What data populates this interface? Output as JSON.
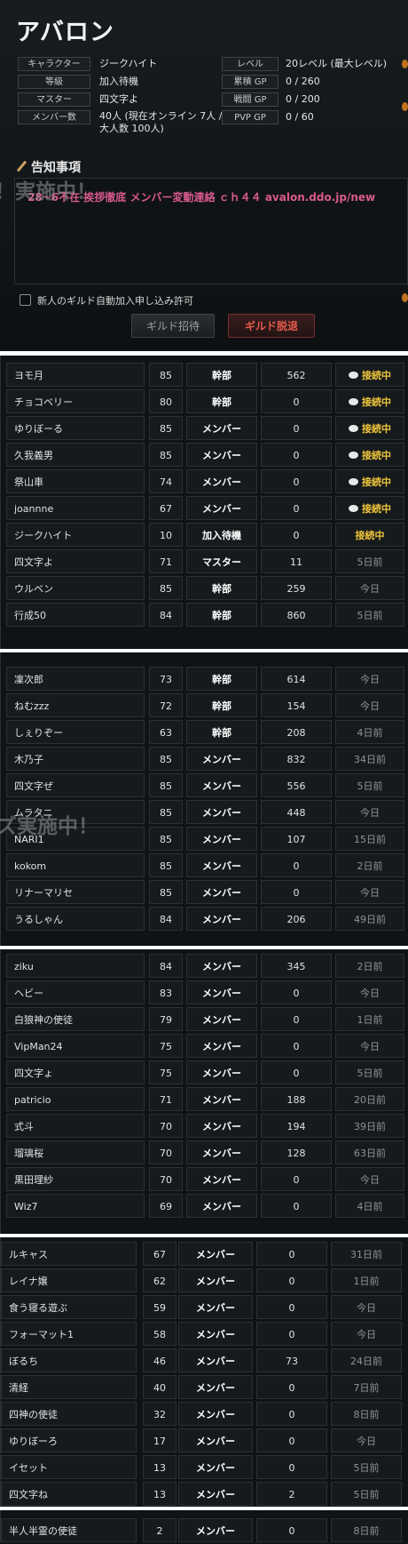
{
  "guild": {
    "name": "アバロン",
    "info_left": [
      {
        "label": "キャラクター",
        "value": "ジークハイト"
      },
      {
        "label": "等級",
        "value": "加入待機"
      },
      {
        "label": "マスター",
        "value": "四文字よ"
      },
      {
        "label": "メンバー数",
        "value": "40人 (現在オンライン 7人 / 最大人数 100人)"
      }
    ],
    "info_right": [
      {
        "label": "レベル",
        "value": "20レベル (最大レベル)"
      },
      {
        "label": "累積 GP",
        "value": "0 / 260"
      },
      {
        "label": "戦闘 GP",
        "value": "0 / 200"
      },
      {
        "label": "PVP GP",
        "value": "0 / 60"
      }
    ],
    "notice_title": "告知事項",
    "notice_text": "28~6不在  挨拶徹底  メンバー変動連絡  ｃｈ４４  avalon.ddo.jp/new",
    "watermark_1": "！実施中！",
    "watermark_2": "ズ実施中！",
    "auto_join_label": "新人のギルド自動加入申し込み許可",
    "invite_button": "ギルド招待",
    "leave_button": "ギルド脱退"
  },
  "members": [
    [
      {
        "name": "ヨモ月",
        "level": "85",
        "rank": "幹部",
        "gp": "562",
        "status": "接続中",
        "online": true
      },
      {
        "name": "チョコベリー",
        "level": "80",
        "rank": "幹部",
        "gp": "0",
        "status": "接続中",
        "online": true
      },
      {
        "name": "ゆりぼーる",
        "level": "85",
        "rank": "メンバー",
        "gp": "0",
        "status": "接続中",
        "online": true
      },
      {
        "name": "久我義男",
        "level": "85",
        "rank": "メンバー",
        "gp": "0",
        "status": "接続中",
        "online": true
      },
      {
        "name": "祭山車",
        "level": "74",
        "rank": "メンバー",
        "gp": "0",
        "status": "接続中",
        "online": true
      },
      {
        "name": "joannne",
        "level": "67",
        "rank": "メンバー",
        "gp": "0",
        "status": "接続中",
        "online": true
      },
      {
        "name": "ジークハイト",
        "level": "10",
        "rank": "加入待機",
        "gp": "0",
        "status": "接続中",
        "online": true,
        "noicon": true
      },
      {
        "name": "四文字よ",
        "level": "71",
        "rank": "マスター",
        "gp": "11",
        "status": "5日前",
        "online": false
      },
      {
        "name": "ウルベン",
        "level": "85",
        "rank": "幹部",
        "gp": "259",
        "status": "今日",
        "online": false
      },
      {
        "name": "行成50",
        "level": "84",
        "rank": "幹部",
        "gp": "860",
        "status": "5日前",
        "online": false
      }
    ],
    [
      {
        "name": "凜次郎",
        "level": "73",
        "rank": "幹部",
        "gp": "614",
        "status": "今日",
        "online": false
      },
      {
        "name": "ねむzzz",
        "level": "72",
        "rank": "幹部",
        "gp": "154",
        "status": "今日",
        "online": false
      },
      {
        "name": "しぇりぞー",
        "level": "63",
        "rank": "幹部",
        "gp": "208",
        "status": "4日前",
        "online": false
      },
      {
        "name": "木乃子",
        "level": "85",
        "rank": "メンバー",
        "gp": "832",
        "status": "34日前",
        "online": false
      },
      {
        "name": "四文字ぜ",
        "level": "85",
        "rank": "メンバー",
        "gp": "556",
        "status": "5日前",
        "online": false
      },
      {
        "name": "ムラタニ",
        "level": "85",
        "rank": "メンバー",
        "gp": "448",
        "status": "今日",
        "online": false
      },
      {
        "name": "NARI1",
        "level": "85",
        "rank": "メンバー",
        "gp": "107",
        "status": "15日前",
        "online": false
      },
      {
        "name": "kokom",
        "level": "85",
        "rank": "メンバー",
        "gp": "0",
        "status": "2日前",
        "online": false
      },
      {
        "name": "リナーマリセ",
        "level": "85",
        "rank": "メンバー",
        "gp": "0",
        "status": "今日",
        "online": false
      },
      {
        "name": "うるしゃん",
        "level": "84",
        "rank": "メンバー",
        "gp": "206",
        "status": "49日前",
        "online": false
      }
    ],
    [
      {
        "name": "ziku",
        "level": "84",
        "rank": "メンバー",
        "gp": "345",
        "status": "2日前",
        "online": false
      },
      {
        "name": "ヘビー",
        "level": "83",
        "rank": "メンバー",
        "gp": "0",
        "status": "今日",
        "online": false
      },
      {
        "name": "白狼神の使徒",
        "level": "79",
        "rank": "メンバー",
        "gp": "0",
        "status": "1日前",
        "online": false
      },
      {
        "name": "VipMan24",
        "level": "75",
        "rank": "メンバー",
        "gp": "0",
        "status": "今日",
        "online": false
      },
      {
        "name": "四文字ょ",
        "level": "75",
        "rank": "メンバー",
        "gp": "0",
        "status": "5日前",
        "online": false
      },
      {
        "name": "patricio",
        "level": "71",
        "rank": "メンバー",
        "gp": "188",
        "status": "20日前",
        "online": false
      },
      {
        "name": "式斗",
        "level": "70",
        "rank": "メンバー",
        "gp": "194",
        "status": "39日前",
        "online": false
      },
      {
        "name": "瑠璃桜",
        "level": "70",
        "rank": "メンバー",
        "gp": "128",
        "status": "63日前",
        "online": false
      },
      {
        "name": "黒田理紗",
        "level": "70",
        "rank": "メンバー",
        "gp": "0",
        "status": "今日",
        "online": false
      },
      {
        "name": "Wiz7",
        "level": "69",
        "rank": "メンバー",
        "gp": "0",
        "status": "4日前",
        "online": false
      }
    ],
    [
      {
        "name": "ルキャス",
        "level": "67",
        "rank": "メンバー",
        "gp": "0",
        "status": "31日前",
        "online": false
      },
      {
        "name": "レイナ嬢",
        "level": "62",
        "rank": "メンバー",
        "gp": "0",
        "status": "1日前",
        "online": false
      },
      {
        "name": "食う寝る遊ぶ",
        "level": "59",
        "rank": "メンバー",
        "gp": "0",
        "status": "今日",
        "online": false
      },
      {
        "name": "フォーマット1",
        "level": "58",
        "rank": "メンバー",
        "gp": "0",
        "status": "今日",
        "online": false
      },
      {
        "name": "ぼるち",
        "level": "46",
        "rank": "メンバー",
        "gp": "73",
        "status": "24日前",
        "online": false
      },
      {
        "name": "清経",
        "level": "40",
        "rank": "メンバー",
        "gp": "0",
        "status": "7日前",
        "online": false
      },
      {
        "name": "四神の使徒",
        "level": "32",
        "rank": "メンバー",
        "gp": "0",
        "status": "8日前",
        "online": false
      },
      {
        "name": "ゆりぼーろ",
        "level": "17",
        "rank": "メンバー",
        "gp": "0",
        "status": "今日",
        "online": false
      },
      {
        "name": "イセット",
        "level": "13",
        "rank": "メンバー",
        "gp": "0",
        "status": "5日前",
        "online": false
      },
      {
        "name": "四文字ね",
        "level": "13",
        "rank": "メンバー",
        "gp": "2",
        "status": "5日前",
        "online": false
      }
    ],
    [
      {
        "name": "半人半霊の使徒",
        "level": "2",
        "rank": "メンバー",
        "gp": "0",
        "status": "8日前",
        "online": false
      }
    ]
  ],
  "colors": {
    "online_status": "#f0c53a",
    "notice_text": "#d85a8e",
    "leave_button": "#e35a4a"
  }
}
